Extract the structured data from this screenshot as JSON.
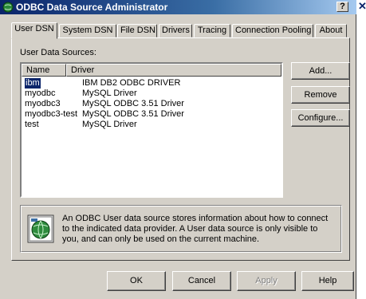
{
  "window": {
    "title": "ODBC Data Source Administrator",
    "help_label": "?",
    "outside_close_glyph": "✕"
  },
  "tabs": [
    {
      "label": "User DSN",
      "active": true
    },
    {
      "label": "System DSN"
    },
    {
      "label": "File DSN"
    },
    {
      "label": "Drivers"
    },
    {
      "label": "Tracing"
    },
    {
      "label": "Connection Pooling"
    },
    {
      "label": "About"
    }
  ],
  "user_dsn": {
    "section_label": "User Data Sources:",
    "columns": [
      "Name",
      "Driver"
    ],
    "rows": [
      {
        "name": "ibm",
        "driver": "IBM DB2 ODBC DRIVER",
        "selected": true
      },
      {
        "name": "myodbc",
        "driver": "MySQL Driver"
      },
      {
        "name": "myodbc3",
        "driver": "MySQL ODBC 3.51 Driver"
      },
      {
        "name": "myodbc3-test",
        "driver": "MySQL ODBC 3.51 Driver"
      },
      {
        "name": "test",
        "driver": "MySQL Driver"
      }
    ],
    "buttons": {
      "add": "Add...",
      "remove": "Remove",
      "configure": "Configure..."
    },
    "info": "An ODBC User data source stores information about how to connect to the indicated data provider.  A User data source is only visible to you, and can only be used on the current machine.",
    "info_icon": "globe-database-icon"
  },
  "footer": {
    "ok": "OK",
    "cancel": "Cancel",
    "apply": "Apply",
    "help": "Help"
  },
  "colors": {
    "titlebar": "#0a246a",
    "face": "#d4d0c8",
    "selection": "#0a246a"
  }
}
